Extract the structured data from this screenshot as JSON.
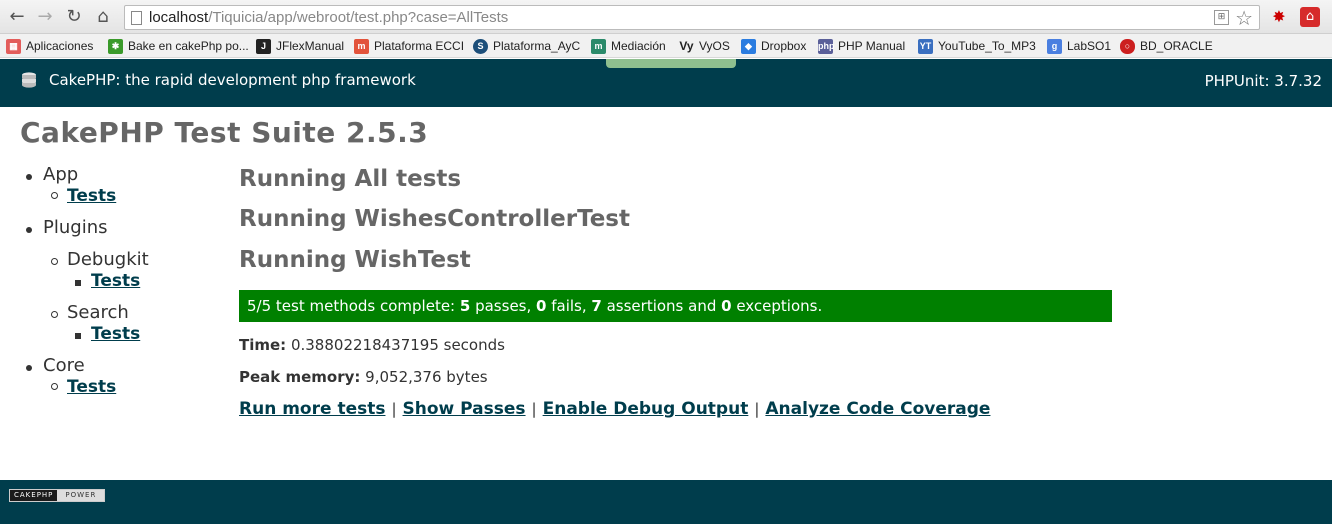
{
  "browser": {
    "url_host": "localhost",
    "url_path": "/Tiquicia/app/webroot/test.php?case=AllTests",
    "bookmarks": [
      {
        "label": "Aplicaciones",
        "icon": "apps-grid-icon",
        "color": "#e35d5b"
      },
      {
        "label": "Bake en cakePhp po...",
        "icon": "puzzle-icon",
        "color": "#3a9a2a"
      },
      {
        "label": "JFlexManual",
        "icon": "jflex-icon",
        "color": "#222222"
      },
      {
        "label": "Plataforma ECCI",
        "icon": "moodle-icon",
        "color": "#e2533b"
      },
      {
        "label": "Plataforma_AyC",
        "icon": "s-circle-icon",
        "color": "#1d4f7a"
      },
      {
        "label": "Mediación",
        "icon": "m-icon",
        "color": "#2a8a6a"
      },
      {
        "label": "VyOS",
        "icon": "vyos-icon",
        "color": "#444444"
      },
      {
        "label": "Dropbox",
        "icon": "dropbox-icon",
        "color": "#2a7ce0"
      },
      {
        "label": "PHP Manual",
        "icon": "php-icon",
        "color": "#5a5f99"
      },
      {
        "label": "YouTube_To_MP3",
        "icon": "yt-mp3-icon",
        "color": "#3a6fc0"
      },
      {
        "label": "LabSO1",
        "icon": "google-g-icon",
        "color": "#4a7fe0"
      },
      {
        "label": "BD_ORACLE",
        "icon": "oracle-icon",
        "color": "#cc1f1f"
      }
    ]
  },
  "header": {
    "title": "CakePHP: the rapid development php framework",
    "phpunit": "PHPUnit: 3.7.32"
  },
  "suite_title": "CakePHP Test Suite 2.5.3",
  "sidebar": {
    "app_label": "App",
    "app_tests": "Tests",
    "plugins_label": "Plugins",
    "debugkit_label": "Debugkit",
    "debugkit_tests": "Tests",
    "search_label": "Search",
    "search_tests": "Tests",
    "core_label": "Core",
    "core_tests": "Tests"
  },
  "running": [
    "Running All tests",
    "Running WishesControllerTest",
    "Running WishTest"
  ],
  "result": {
    "prefix": "5/5 test methods complete: ",
    "passes": "5",
    "passes_label": " passes, ",
    "fails": "0",
    "fails_label": " fails, ",
    "assertions": "7",
    "assertions_label": " assertions and ",
    "exceptions": "0",
    "exceptions_label": " exceptions.",
    "color": "#008000"
  },
  "time": {
    "label": "Time:",
    "value": " 0.38802218437195 seconds"
  },
  "memory": {
    "label": "Peak memory:",
    "value": " 9,052,376 bytes"
  },
  "actions": {
    "run_more": "Run more tests",
    "show_passes": "Show Passes",
    "enable_debug": "Enable Debug Output",
    "analyze_coverage": "Analyze Code Coverage",
    "separator": "|"
  },
  "footer": {
    "power_left": "CAKEPHP",
    "power_right": "POWER"
  },
  "colors": {
    "brand": "#003d4c",
    "pass": "#008000"
  }
}
